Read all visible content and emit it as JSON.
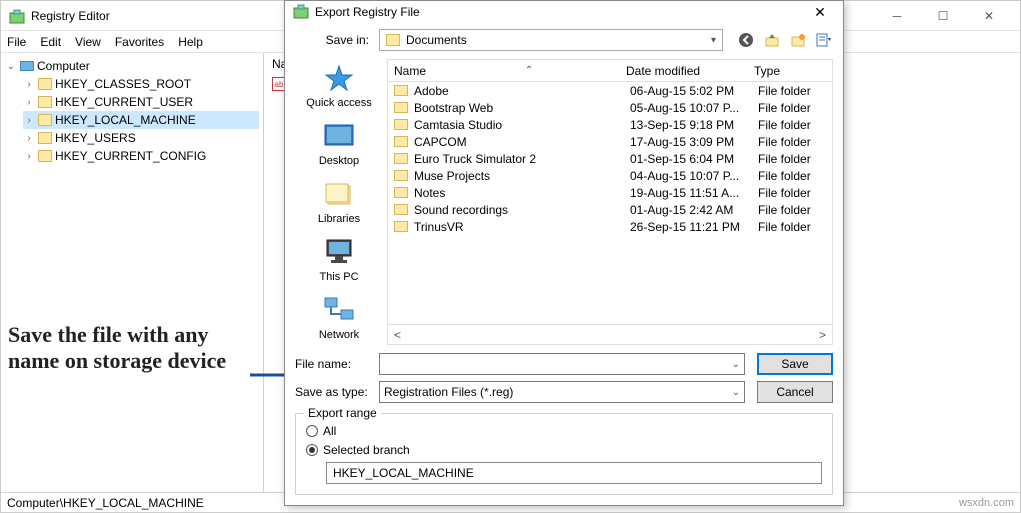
{
  "main_window": {
    "title": "Registry Editor",
    "menu": [
      "File",
      "Edit",
      "View",
      "Favorites",
      "Help"
    ],
    "tree_root": "Computer",
    "tree_items": [
      "HKEY_CLASSES_ROOT",
      "HKEY_CURRENT_USER",
      "HKEY_LOCAL_MACHINE",
      "HKEY_USERS",
      "HKEY_CURRENT_CONFIG"
    ],
    "tree_selected_index": 2,
    "right_header": "Na",
    "status_path": "Computer\\HKEY_LOCAL_MACHINE",
    "watermark": "wsxdn.com"
  },
  "dialog": {
    "title": "Export Registry File",
    "save_in_label": "Save in:",
    "save_in_value": "Documents",
    "places": [
      "Quick access",
      "Desktop",
      "Libraries",
      "This PC",
      "Network"
    ],
    "list_headers": {
      "name": "Name",
      "date": "Date modified",
      "type": "Type"
    },
    "rows": [
      {
        "name": "Adobe",
        "date": "06-Aug-15 5:02 PM",
        "type": "File folder"
      },
      {
        "name": "Bootstrap Web",
        "date": "05-Aug-15 10:07 P...",
        "type": "File folder"
      },
      {
        "name": "Camtasia Studio",
        "date": "13-Sep-15 9:18 PM",
        "type": "File folder"
      },
      {
        "name": "CAPCOM",
        "date": "17-Aug-15 3:09 PM",
        "type": "File folder"
      },
      {
        "name": "Euro Truck Simulator 2",
        "date": "01-Sep-15 6:04 PM",
        "type": "File folder"
      },
      {
        "name": "Muse Projects",
        "date": "04-Aug-15 10:07 P...",
        "type": "File folder"
      },
      {
        "name": "Notes",
        "date": "19-Aug-15 11:51 A...",
        "type": "File folder"
      },
      {
        "name": "Sound recordings",
        "date": "01-Aug-15 2:42 AM",
        "type": "File folder"
      },
      {
        "name": "TrinusVR",
        "date": "26-Sep-15 11:21 PM",
        "type": "File folder"
      }
    ],
    "file_name_label": "File name:",
    "file_name_value": "",
    "save_type_label": "Save as type:",
    "save_type_value": "Registration Files (*.reg)",
    "save_button": "Save",
    "cancel_button": "Cancel",
    "export_range": {
      "legend": "Export range",
      "all": "All",
      "selected_branch": "Selected branch",
      "branch_value": "HKEY_LOCAL_MACHINE"
    },
    "footer_left": "<",
    "footer_right": ">"
  },
  "annotation": "Save the file with any name on storage device"
}
